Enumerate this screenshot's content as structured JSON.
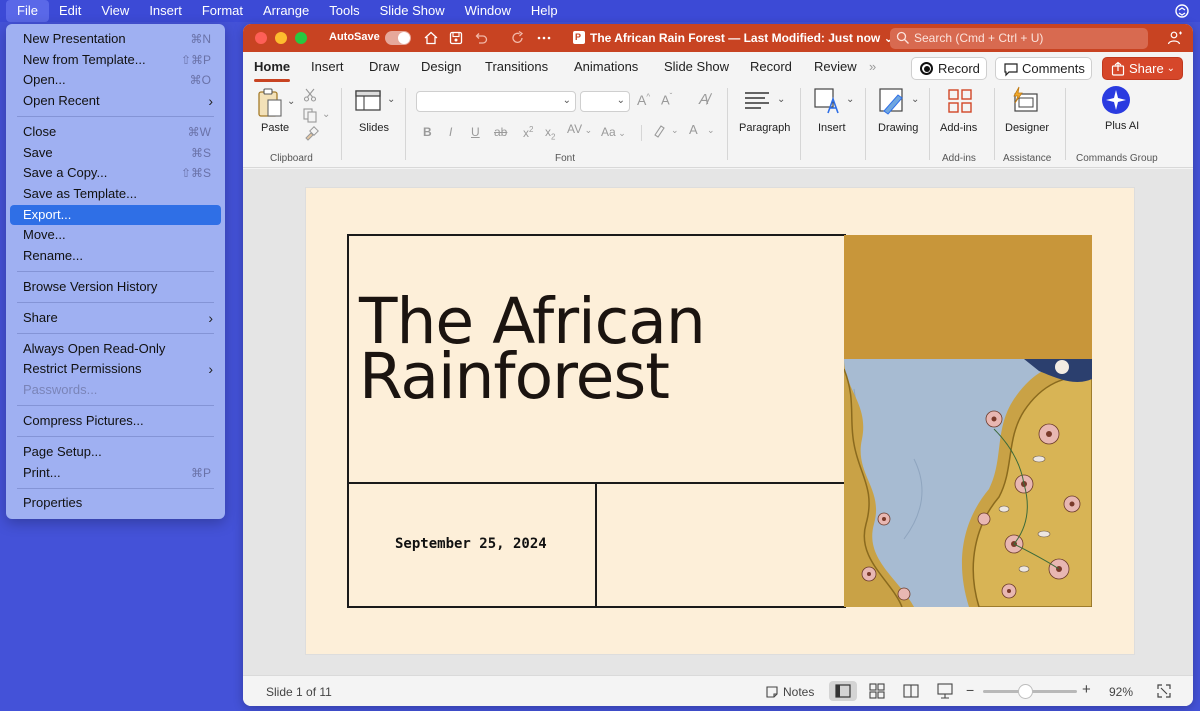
{
  "menubar": {
    "items": [
      "File",
      "Edit",
      "View",
      "Insert",
      "Format",
      "Arrange",
      "Tools",
      "Slide Show",
      "Window",
      "Help"
    ],
    "active": "File"
  },
  "file_menu": {
    "items": [
      {
        "label": "New Presentation",
        "shortcut": "⌘N"
      },
      {
        "label": "New from Template...",
        "shortcut": "⇧⌘P"
      },
      {
        "label": "Open...",
        "shortcut": "⌘O"
      },
      {
        "label": "Open Recent",
        "submenu": true
      },
      {
        "label": "Close",
        "shortcut": "⌘W"
      },
      {
        "label": "Save",
        "shortcut": "⌘S"
      },
      {
        "label": "Save a Copy...",
        "shortcut": "⇧⌘S"
      },
      {
        "label": "Save as Template..."
      },
      {
        "label": "Export...",
        "highlighted": true
      },
      {
        "label": "Move..."
      },
      {
        "label": "Rename..."
      },
      {
        "label": "Browse Version History"
      },
      {
        "label": "Share",
        "submenu": true
      },
      {
        "label": "Always Open Read-Only"
      },
      {
        "label": "Restrict Permissions",
        "submenu": true
      },
      {
        "label": "Passwords...",
        "disabled": true
      },
      {
        "label": "Compress Pictures..."
      },
      {
        "label": "Page Setup..."
      },
      {
        "label": "Print...",
        "shortcut": "⌘P"
      },
      {
        "label": "Properties"
      }
    ]
  },
  "titlebar": {
    "autosave_label": "AutoSave",
    "document_title": "The African Rain Forest — Last Modified: Just now ⌄",
    "search_placeholder": "Search (Cmd + Ctrl + U)",
    "accent_color": "#c84322"
  },
  "ribbon_tabs": [
    "Home",
    "Insert",
    "Draw",
    "Design",
    "Transitions",
    "Animations",
    "Slide Show",
    "Record",
    "Review"
  ],
  "active_tab": "Home",
  "ribbon_buttons": {
    "record": "Record",
    "comments": "Comments",
    "share": "Share"
  },
  "ribbon": {
    "paste": "Paste",
    "slides": "Slides",
    "paragraph": "Paragraph",
    "insert": "Insert",
    "drawing": "Drawing",
    "addins": "Add-ins",
    "designer": "Designer",
    "plus_ai": "Plus AI",
    "groups": {
      "clipboard": "Clipboard",
      "font": "Font",
      "addins": "Add-ins",
      "assistance": "Assistance",
      "commands": "Commands Group"
    }
  },
  "slide": {
    "title_line1": "The African",
    "title_line2": "Rainforest",
    "date": "September 25, 2024",
    "background_color": "#fdefd9",
    "gold_color": "#c8963a"
  },
  "statusbar": {
    "slide_indicator": "Slide 1 of 11",
    "notes_label": "Notes",
    "zoom_percent": "92%",
    "zoom_value": 0.92
  }
}
